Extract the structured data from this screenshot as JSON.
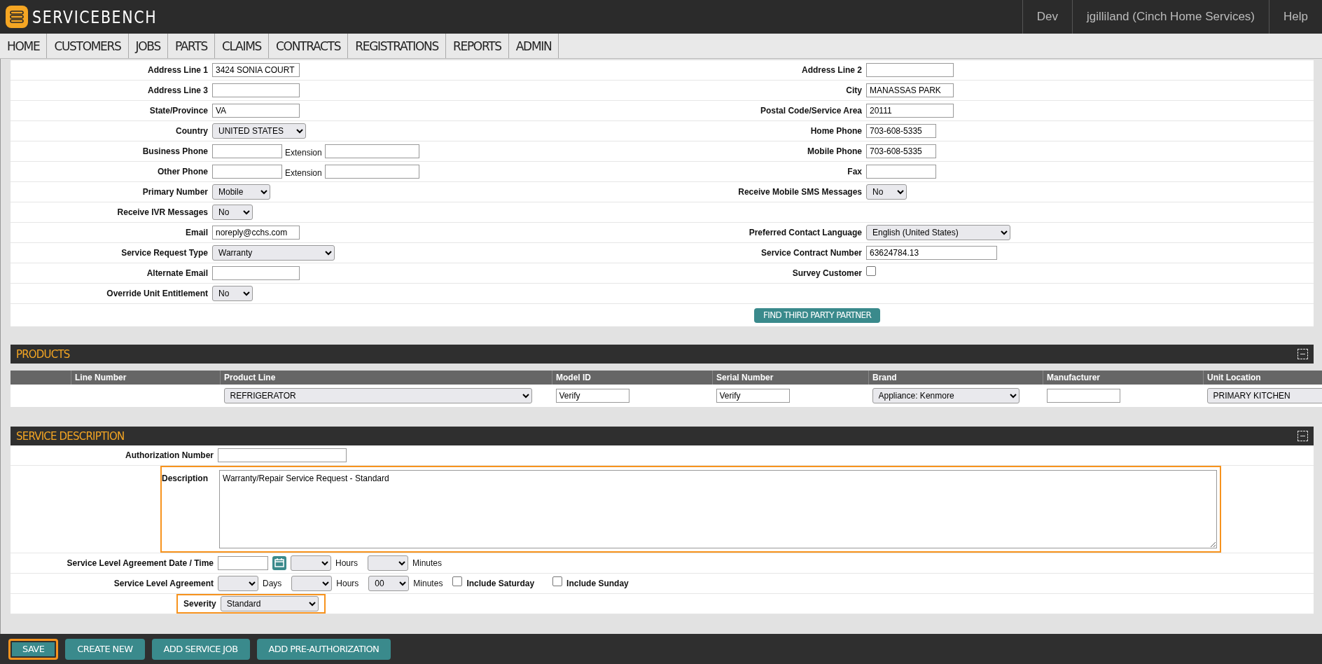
{
  "header": {
    "logo_text": "SERVICEBENCH",
    "links": [
      "Dev",
      "jgilliland (Cinch Home Services)",
      "Help"
    ]
  },
  "nav": [
    {
      "label": "HOME"
    },
    {
      "label": "CUSTOMERS"
    },
    {
      "label": "JOBS"
    },
    {
      "label": "PARTS"
    },
    {
      "label": "CLAIMS"
    },
    {
      "label": "CONTRACTS"
    },
    {
      "label": "REGISTRATIONS"
    },
    {
      "label": "REPORTS"
    },
    {
      "label": "ADMIN"
    }
  ],
  "form_rows": [
    {
      "left": {
        "label": "Address Line 1",
        "kind": "input",
        "value": "3424 SONIA COURT"
      },
      "right": {
        "label": "Address Line 2",
        "kind": "input"
      }
    },
    {
      "left": {
        "label": "Address Line 3",
        "kind": "input"
      },
      "right": {
        "label": "City",
        "kind": "input",
        "value": "MANASSAS PARK"
      }
    },
    {
      "left": {
        "label": "State/Province",
        "kind": "input",
        "value": "VA"
      },
      "right": {
        "label": "Postal Code/Service Area",
        "kind": "input",
        "value": "20111"
      }
    },
    {
      "left": {
        "label": "Country",
        "kind": "select",
        "value": "UNITED STATES"
      },
      "right": {
        "label": "Home Phone",
        "kind": "input",
        "value": "703-608-5335"
      }
    },
    {
      "left": {
        "label": "Business Phone",
        "kind": "input_ext",
        "extension_label": "Extension"
      },
      "right": {
        "label": "Mobile Phone",
        "kind": "input",
        "value": "703-608-5335"
      }
    },
    {
      "left": {
        "label": "Other Phone",
        "kind": "input_ext",
        "extension_label": "Extension"
      },
      "right": {
        "label": "Fax",
        "kind": "input"
      }
    },
    {
      "left": {
        "label": "Primary Number",
        "kind": "select",
        "value": "Mobile"
      },
      "right": {
        "label": "Receive Mobile SMS Messages",
        "kind": "select",
        "value": "No"
      }
    },
    {
      "left": {
        "label": "Receive IVR Messages",
        "kind": "select",
        "value": "No"
      }
    },
    {
      "left": {
        "label": "Email",
        "kind": "input",
        "value": "noreply@cchs.com"
      },
      "right": {
        "label": "Preferred Contact Language",
        "kind": "select",
        "value": "English (United States)"
      }
    },
    {
      "left": {
        "label": "Service Request Type",
        "kind": "select",
        "value": "Warranty"
      },
      "right": {
        "label": "Service Contract Number",
        "kind": "input",
        "value": "63624784.13"
      }
    },
    {
      "left": {
        "label": "Alternate Email",
        "kind": "input"
      },
      "right": {
        "label": "Survey Customer",
        "kind": "checkbox",
        "checked": false
      }
    },
    {
      "left": {
        "label": "Override Unit Entitlement",
        "kind": "select",
        "value": "No"
      }
    }
  ],
  "partner_button": "FIND THIRD PARTY PARTNER",
  "products": {
    "title": "PRODUCTS",
    "columns": [
      null,
      "Line Number",
      "Product Line",
      "Model ID",
      "Serial Number",
      "Brand",
      "Manufacturer",
      "Unit Location"
    ],
    "row": [
      {
        "kind": "empty"
      },
      {
        "kind": "empty"
      },
      {
        "kind": "select",
        "value": "REFRIGERATOR"
      },
      {
        "kind": "input",
        "value": "Verify"
      },
      {
        "kind": "input",
        "value": "Verify"
      },
      {
        "kind": "select",
        "value": "Appliance: Kenmore"
      },
      {
        "kind": "input"
      },
      {
        "kind": "select",
        "value": "PRIMARY KITCHEN"
      }
    ]
  },
  "service": {
    "title": "SERVICE DESCRIPTION",
    "rows": [
      {
        "label": "Authorization Number",
        "highlighted": false,
        "controls": [
          {
            "kind": "input"
          }
        ]
      },
      {
        "label": "Description",
        "highlighted": true,
        "controls": [
          {
            "kind": "textarea",
            "value": "Warranty/Repair Service Request - Standard"
          }
        ]
      },
      {
        "label": "Service Level Agreement Date / Time",
        "highlighted": false,
        "controls": [
          {
            "kind": "input"
          },
          {
            "kind": "calendar"
          },
          {
            "kind": "select"
          },
          {
            "kind": "text",
            "value": "Hours"
          },
          {
            "kind": "select"
          },
          {
            "kind": "text",
            "value": "Minutes"
          }
        ]
      },
      {
        "label": "Service Level Agreement",
        "highlighted": false,
        "controls": [
          {
            "kind": "select"
          },
          {
            "kind": "text",
            "value": "Days"
          },
          {
            "kind": "select"
          },
          {
            "kind": "text",
            "value": "Hours"
          },
          {
            "kind": "select",
            "value": "00"
          },
          {
            "kind": "text",
            "value": "Minutes"
          },
          {
            "kind": "checkbox",
            "label": "Include Saturday",
            "checked": false
          },
          {
            "kind": "checkbox",
            "label": "Include Sunday",
            "checked": false
          }
        ]
      },
      {
        "label": "Severity",
        "highlighted": true,
        "controls": [
          {
            "kind": "select",
            "value": "Standard"
          }
        ]
      }
    ]
  },
  "footer": [
    {
      "label": "SAVE",
      "highlighted": true
    },
    {
      "label": "CREATE NEW",
      "highlighted": false
    },
    {
      "label": "ADD SERVICE JOB",
      "highlighted": false
    },
    {
      "label": "ADD PRE-AUTHORIZATION",
      "highlighted": false
    }
  ]
}
